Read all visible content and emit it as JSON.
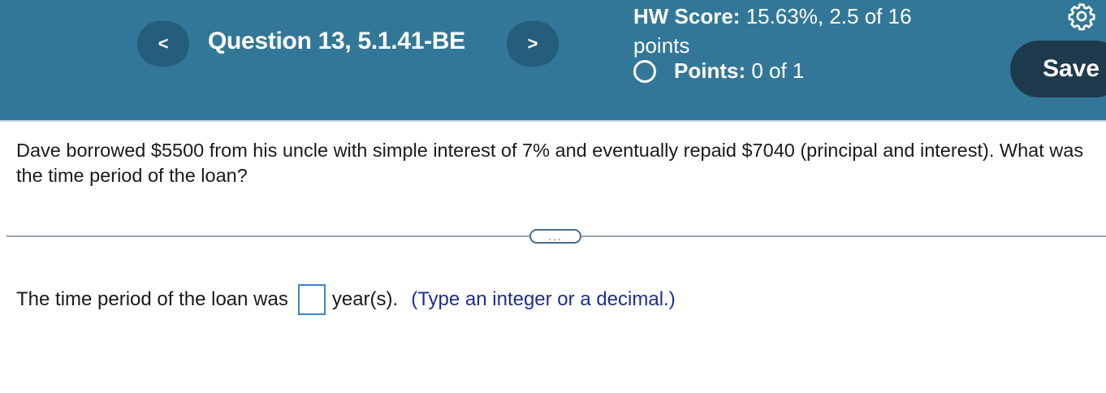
{
  "header": {
    "prev_label": "<",
    "next_label": ">",
    "question_title": "Question 13, 5.1.41-BE",
    "hw_score_label": "HW Score:",
    "hw_score_value": "15.63%, 2.5 of 16 points",
    "points_label": "Points:",
    "points_value": "0 of 1",
    "save_label": "Save",
    "settings_icon": "gear-icon"
  },
  "question": {
    "text": "Dave borrowed $5500 from his uncle with simple interest of 7% and eventually repaid $7040 (principal and interest). What was the time period of the loan?"
  },
  "more_label": "...",
  "answer": {
    "prefix": "The time period of the loan was",
    "value": "",
    "unit": "year(s).",
    "hint": "(Type an integer or a decimal.)"
  },
  "colors": {
    "header_bg": "#337798",
    "nav_button_bg": "#255d7c",
    "save_button_bg": "#1e3a4d",
    "hint_text": "#1c2f8f",
    "answer_box_border": "#3b86c9"
  }
}
